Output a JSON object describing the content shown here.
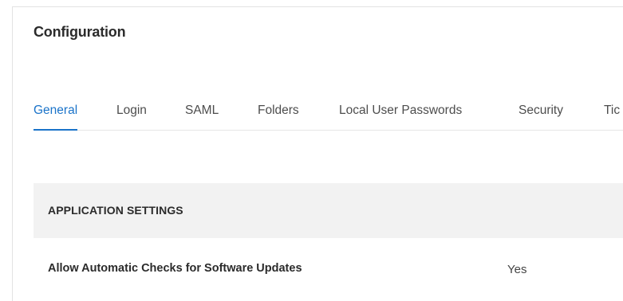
{
  "page": {
    "title": "Configuration"
  },
  "tabs": [
    {
      "label": "General",
      "active": true
    },
    {
      "label": "Login",
      "active": false
    },
    {
      "label": "SAML",
      "active": false
    },
    {
      "label": "Folders",
      "active": false
    },
    {
      "label": "Local User Passwords",
      "active": false
    },
    {
      "label": "Security",
      "active": false
    },
    {
      "label": "Tic",
      "active": false
    }
  ],
  "section": {
    "title": "APPLICATION SETTINGS"
  },
  "settings": [
    {
      "label": "Allow Automatic Checks for Software Updates",
      "value": "Yes"
    }
  ],
  "colors": {
    "accent": "#1a73c9",
    "section_background": "#f2f2f2"
  }
}
